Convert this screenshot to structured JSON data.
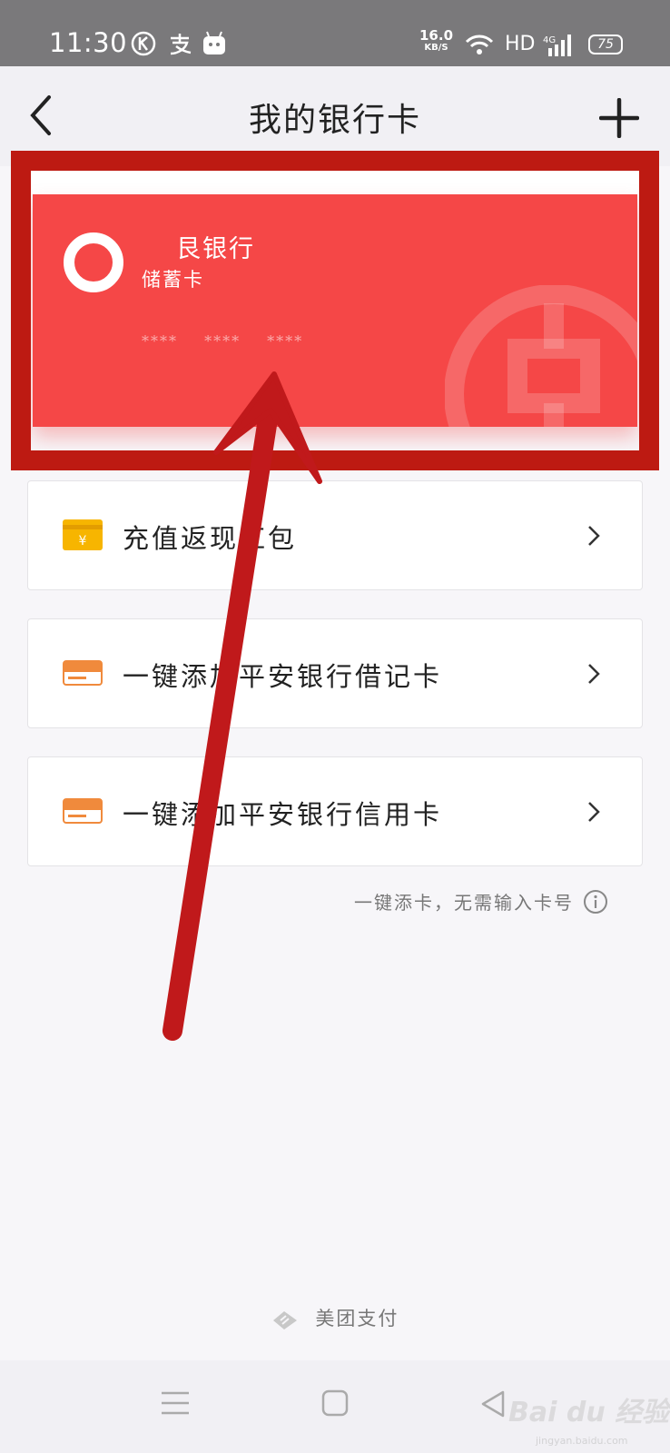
{
  "status_bar": {
    "time": "11:30",
    "left_icons": [
      "k-app-icon",
      "alipay-icon",
      "robot-app-icon"
    ],
    "net_speed": "16.0",
    "net_speed_unit": "KB/S",
    "network_type": "HD",
    "signal": "4G",
    "battery": "75"
  },
  "header": {
    "title": "我的银行卡",
    "back_icon": "chevron-left-icon",
    "add_icon": "plus-icon"
  },
  "card": {
    "bank_name": "艮银行",
    "card_type": "储蓄卡",
    "number_mask": "**** **** ****",
    "color": "#f54747"
  },
  "list": [
    {
      "label": "充值返现红包",
      "icon": "yuan-card-icon"
    },
    {
      "label": "一键添加平安银行借记卡",
      "icon": "pingan-card-icon"
    },
    {
      "label": "一键添加平安银行信用卡",
      "icon": "pingan-card-icon"
    }
  ],
  "hint": "一键添卡，无需输入卡号",
  "footer_brand": "美团支付",
  "watermark": {
    "brand": "Bai du 经验",
    "url": "jingyan.baidu.com"
  },
  "annotation": {
    "frame_color": "#bd1a12"
  }
}
